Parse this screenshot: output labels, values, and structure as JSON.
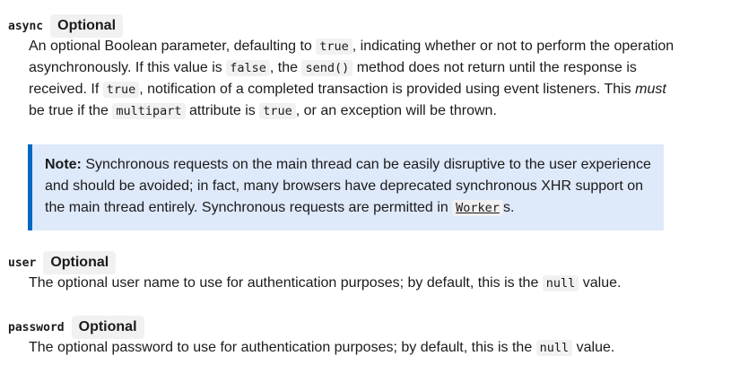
{
  "params": {
    "async": {
      "name": "async",
      "badge": "Optional",
      "desc": {
        "t1": "An optional Boolean parameter, defaulting to ",
        "c1": "true",
        "t2": ", indicating whether or not to perform the operation asynchronously. If this value is ",
        "c2": "false",
        "t3": ", the ",
        "c3": "send()",
        "t4": " method does not return until the response is received. If ",
        "c4": "true",
        "t5": ", notification of a completed transaction is provided using event listeners. This ",
        "em": "must",
        "t6": " be true if the ",
        "c5": "multipart",
        "t7": " attribute is ",
        "c6": "true",
        "t8": ", or an exception will be thrown."
      }
    },
    "user": {
      "name": "user",
      "badge": "Optional",
      "desc": {
        "t1": "The optional user name to use for authentication purposes; by default, this is the ",
        "c1": "null",
        "t2": " value."
      }
    },
    "password": {
      "name": "password",
      "badge": "Optional",
      "desc": {
        "t1": "The optional password to use for authentication purposes; by default, this is the ",
        "c1": "null",
        "t2": " value."
      }
    }
  },
  "note": {
    "label": "Note:",
    "t1": " Synchronous requests on the main thread can be easily disruptive to the user experience and should be avoided; in fact, many browsers have deprecated synchronous XHR support on the main thread entirely. Synchronous requests are permitted in ",
    "link": "Worker",
    "t2": "s."
  },
  "colors": {
    "note_background": "#dee9fa",
    "note_border": "#0069c2",
    "badge_background": "#f2f1f1",
    "text": "#1b1b1b"
  }
}
